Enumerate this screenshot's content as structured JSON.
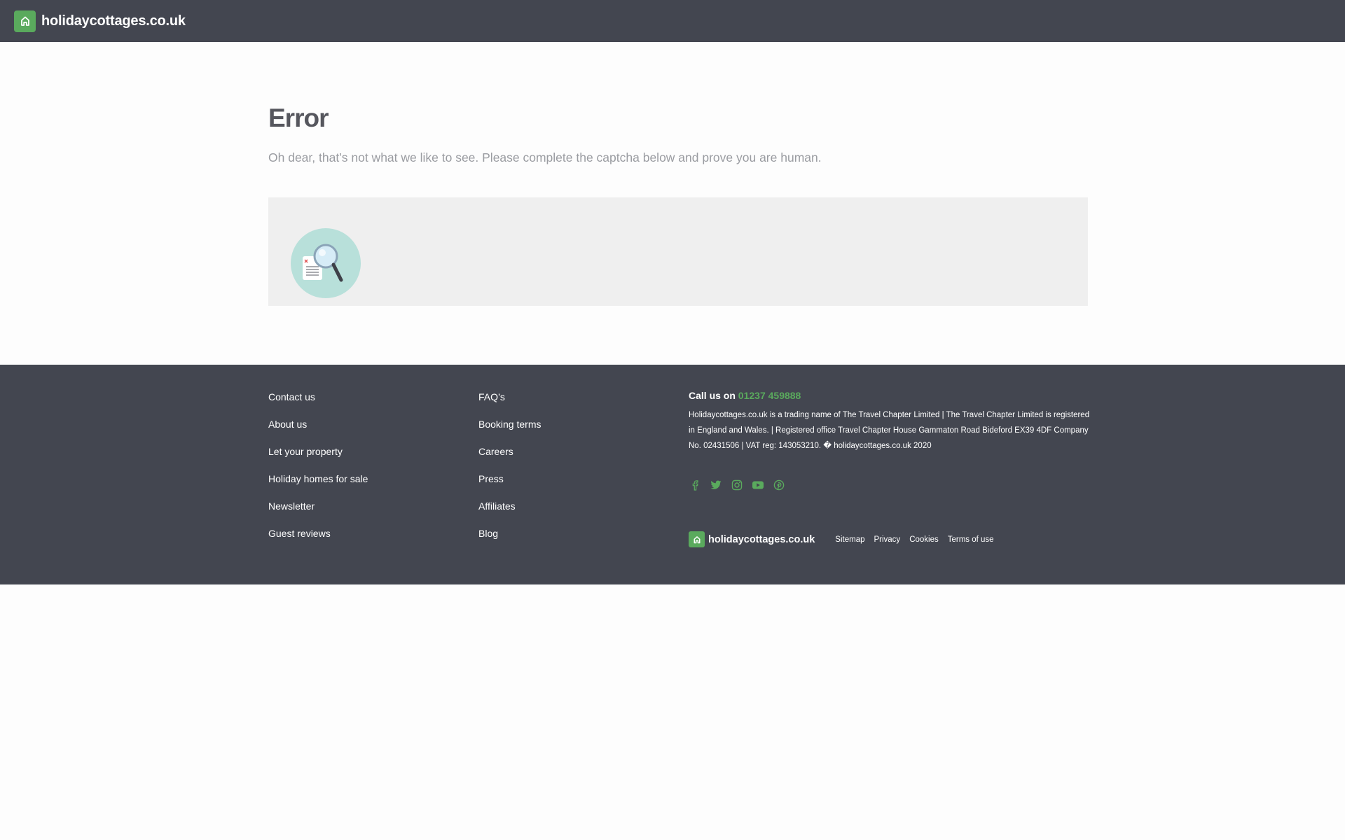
{
  "header": {
    "brand_name": "holidaycottages.co.uk",
    "brand_icon": "house-icon"
  },
  "main": {
    "title": "Error",
    "message": "Oh dear, that’s not what we like to see. Please complete the captcha below and prove you are human.",
    "captcha_illustration": "magnifying-glass-document-icon"
  },
  "footer": {
    "column_one": [
      {
        "label": "Contact us"
      },
      {
        "label": "About us"
      },
      {
        "label": "Let your property"
      },
      {
        "label": "Holiday homes for sale"
      },
      {
        "label": "Newsletter"
      },
      {
        "label": "Guest reviews"
      }
    ],
    "column_two": [
      {
        "label": "FAQ’s"
      },
      {
        "label": "Booking terms"
      },
      {
        "label": "Careers"
      },
      {
        "label": "Press"
      },
      {
        "label": "Affiliates"
      },
      {
        "label": "Blog"
      }
    ],
    "call_label": "Call us on",
    "phone": "01237 459888",
    "legal": "Holidaycottages.co.uk is a trading name of The Travel Chapter Limited | The Travel Chapter Limited is registered in England and Wales. | Registered office Travel Chapter House Gammaton Road Bideford EX39 4DF Company No. 02431506 | VAT reg: 143053210. � holidaycottages.co.uk 2020",
    "social": [
      "facebook-icon",
      "twitter-icon",
      "instagram-icon",
      "youtube-icon",
      "pinterest-icon"
    ],
    "brand_name": "holidaycottages.co.uk",
    "bottom_links": [
      {
        "label": "Sitemap"
      },
      {
        "label": "Privacy"
      },
      {
        "label": "Cookies"
      },
      {
        "label": "Terms of use"
      }
    ]
  },
  "colors": {
    "header_bg": "#434650",
    "brand_green": "#5aaa5d",
    "title_text": "#56575e",
    "message_text": "#9a9ca1",
    "captcha_bg": "#efefef",
    "page_bg": "#fdfdfd"
  }
}
